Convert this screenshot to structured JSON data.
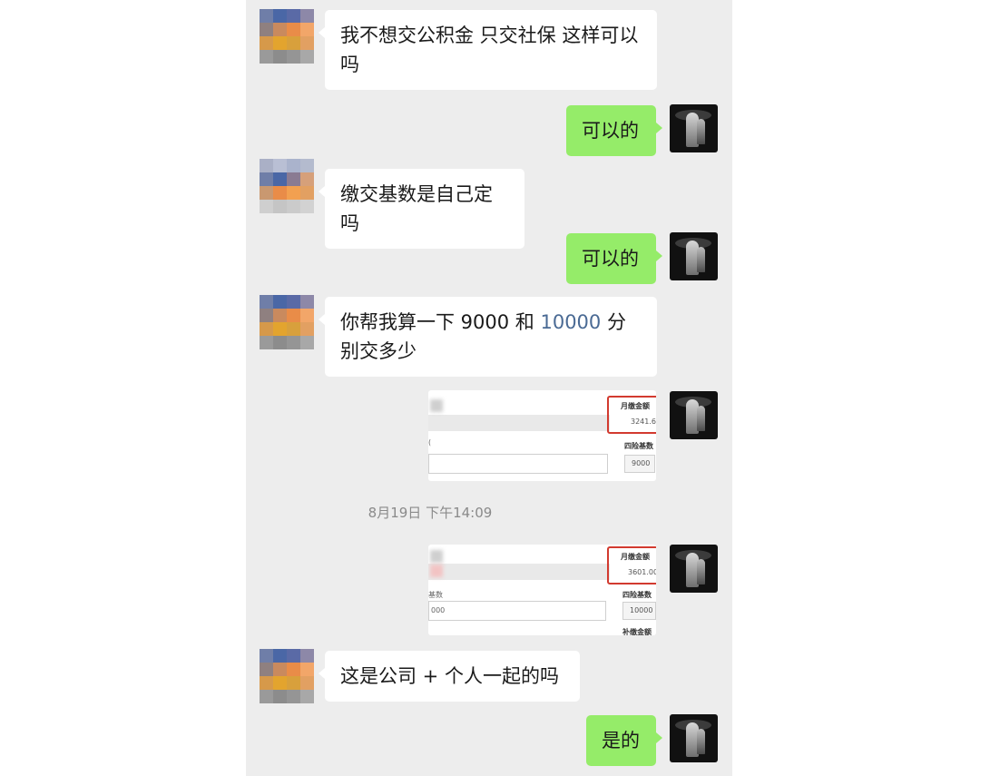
{
  "messages": {
    "m1": {
      "text": "我不想交公积金 只交社保 这样可以吗"
    },
    "m2": {
      "text": "可以的"
    },
    "m3": {
      "text": "缴交基数是自己定吗"
    },
    "m4": {
      "text": "可以的"
    },
    "m5": {
      "pre": "你帮我算一下 9000 和 ",
      "highlight": "10000",
      "post": " 分别交多少"
    },
    "m7": {
      "text": "这是公司 + 个人一起的吗"
    },
    "m8": {
      "text": "是的"
    }
  },
  "timestamp": "8月19日 下午14:09",
  "screenshot1": {
    "monthly_label": "月缴金额",
    "monthly_value": "3241.6",
    "base_label": "四险基数",
    "base_value": "9000",
    "frag": "(",
    "highlight_color": "#d23a2f"
  },
  "screenshot2": {
    "monthly_label": "月缴金额",
    "monthly_value": "3601.00",
    "base_label": "四险基数",
    "base_value": "10000",
    "left_label": "基数",
    "left_value": "000",
    "supp_label": "补缴金额",
    "highlight_color": "#d23a2f"
  },
  "colors": {
    "chat_bg": "#ededed",
    "incoming_bubble": "#ffffff",
    "outgoing_bubble": "#95ec69",
    "link_number": "#4a6a94"
  },
  "icons": {
    "contact_avatar": "pixelated-avatar-icon",
    "self_avatar": "dark-photo-avatar-icon"
  }
}
